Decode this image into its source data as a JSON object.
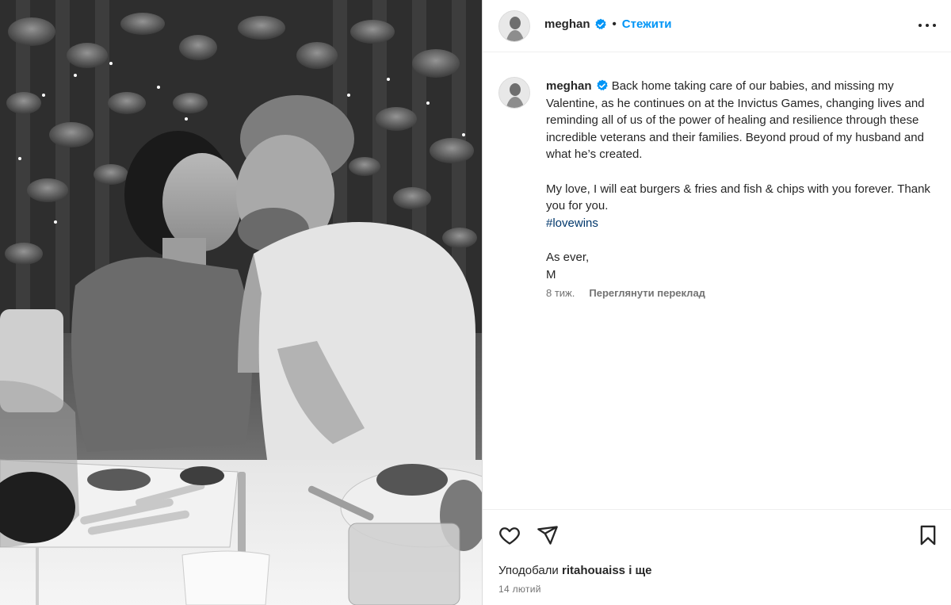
{
  "post": {
    "image_alt": "Black and white photo of a couple kissing at a dinner table surrounded by foliage and string lights",
    "author": {
      "username": "meghan",
      "verified": true
    },
    "header": {
      "separator": "•",
      "follow_label": "Стежити",
      "more_icon": "more-options-icon"
    },
    "caption": {
      "lines": [
        "Back home taking care of our babies, and missing my Valentine, as he continues on at the Invictus Games, changing lives and reminding all of us of the power of healing and resilience through these incredible veterans and their families. Beyond proud of my husband and what he’s created.",
        "My love, I will eat burgers & fries and fish & chips with you forever. Thank you for you."
      ],
      "hashtag": "#lovewins",
      "signoff_1": "As ever,",
      "signoff_2": "M"
    },
    "meta": {
      "time_ago": "8 тиж.",
      "translate_label": "Переглянути переклад"
    },
    "actions": {
      "icons": [
        "heart-icon",
        "share-icon",
        "bookmark-icon"
      ]
    },
    "likes": {
      "prefix": "Уподобали",
      "user": "ritahouaiss",
      "suffix": "і ще"
    },
    "date": "14 лютий"
  },
  "colors": {
    "link_blue": "#0095f6",
    "hashtag": "#00376b",
    "muted": "#737373",
    "text": "#262626",
    "border": "#dbdbdb"
  }
}
